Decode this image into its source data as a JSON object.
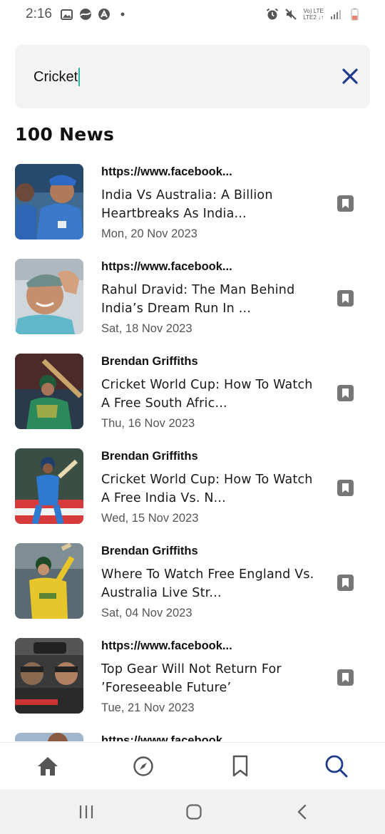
{
  "status_bar": {
    "time": "2:16",
    "network_top": "Vo) LTE",
    "network_bottom": "LTE2 ↓↑",
    "icons": [
      "gallery-icon",
      "data-saver-icon",
      "app-icon",
      "dot-icon",
      "alarm-icon",
      "mute-icon",
      "signal-icon",
      "battery-icon"
    ]
  },
  "search": {
    "query": "Cricket",
    "caret_color": "#2bb3a6",
    "clear_icon": "close-icon",
    "clear_color": "#1f3c8a"
  },
  "results_heading": "100 News",
  "news": [
    {
      "source": "https://www.facebook...",
      "title": "India Vs Australia: A Billion Heartbreaks As India...",
      "date": "Mon, 20 Nov 2023"
    },
    {
      "source": "https://www.facebook...",
      "title": "Rahul Dravid: The Man Behind India’s Dream Run In ...",
      "date": "Sat, 18 Nov 2023"
    },
    {
      "source": "Brendan Griffiths",
      "title": "Cricket World Cup: How To Watch A Free South Afric...",
      "date": "Thu, 16 Nov 2023"
    },
    {
      "source": "Brendan Griffiths",
      "title": "Cricket World Cup: How To Watch A Free India Vs. N...",
      "date": "Wed, 15 Nov 2023"
    },
    {
      "source": "Brendan Griffiths",
      "title": "Where To Watch Free England Vs. Australia Live Str...",
      "date": "Sat, 04 Nov 2023"
    },
    {
      "source": "https://www.facebook...",
      "title": "Top Gear Will Not Return For ’Foreseeable Future’",
      "date": "Tue, 21 Nov 2023"
    },
    {
      "source": "https://www.facebook...",
      "title": "",
      "date": ""
    }
  ],
  "bottom_nav": {
    "items": [
      {
        "name": "home",
        "icon": "home-icon",
        "active": false
      },
      {
        "name": "explore",
        "icon": "compass-icon",
        "active": false
      },
      {
        "name": "bookmarks",
        "icon": "bookmark-icon",
        "active": false
      },
      {
        "name": "search",
        "icon": "search-icon",
        "active": true
      }
    ],
    "active_color": "#1f3c8a",
    "inactive_color": "#555555"
  },
  "system_nav": [
    "recent-apps-icon",
    "home-button-icon",
    "back-icon"
  ]
}
